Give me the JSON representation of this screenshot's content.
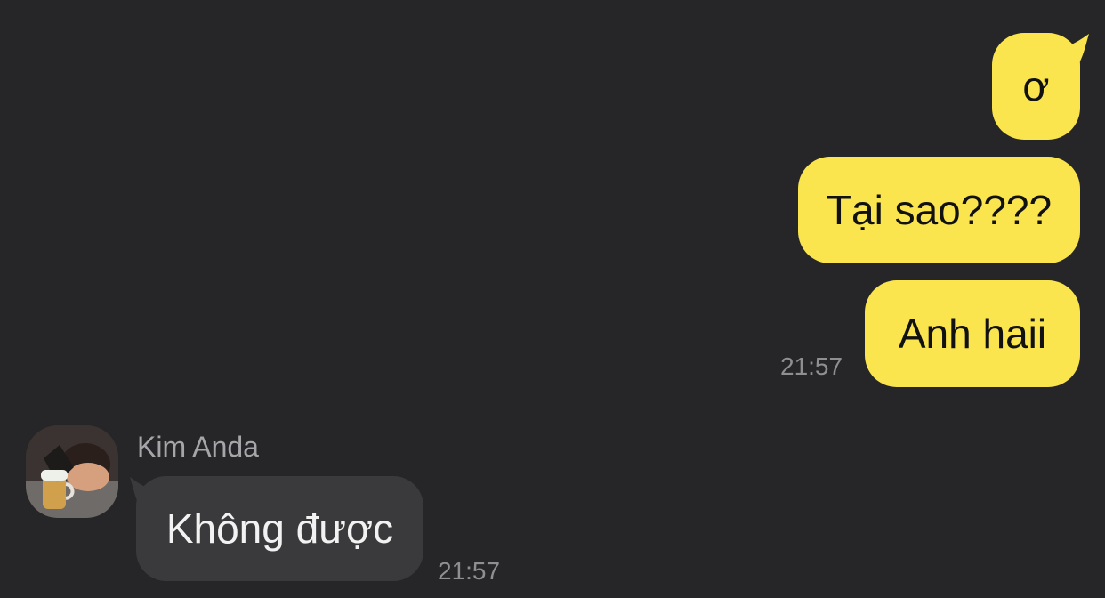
{
  "colors": {
    "background": "#262628",
    "outgoing_bubble": "#fbe54e",
    "incoming_bubble": "#3a3a3c",
    "timestamp": "#8f8f93",
    "sender_name": "#a6a6aa"
  },
  "messages_out": [
    {
      "text": "ơ"
    },
    {
      "text": "Tại sao????"
    },
    {
      "text": "Anh haii"
    }
  ],
  "time_out": "21:57",
  "incoming": {
    "sender": "Kim Anda",
    "text": "Không được",
    "time": "21:57",
    "avatar_icon": "profile-photo"
  }
}
